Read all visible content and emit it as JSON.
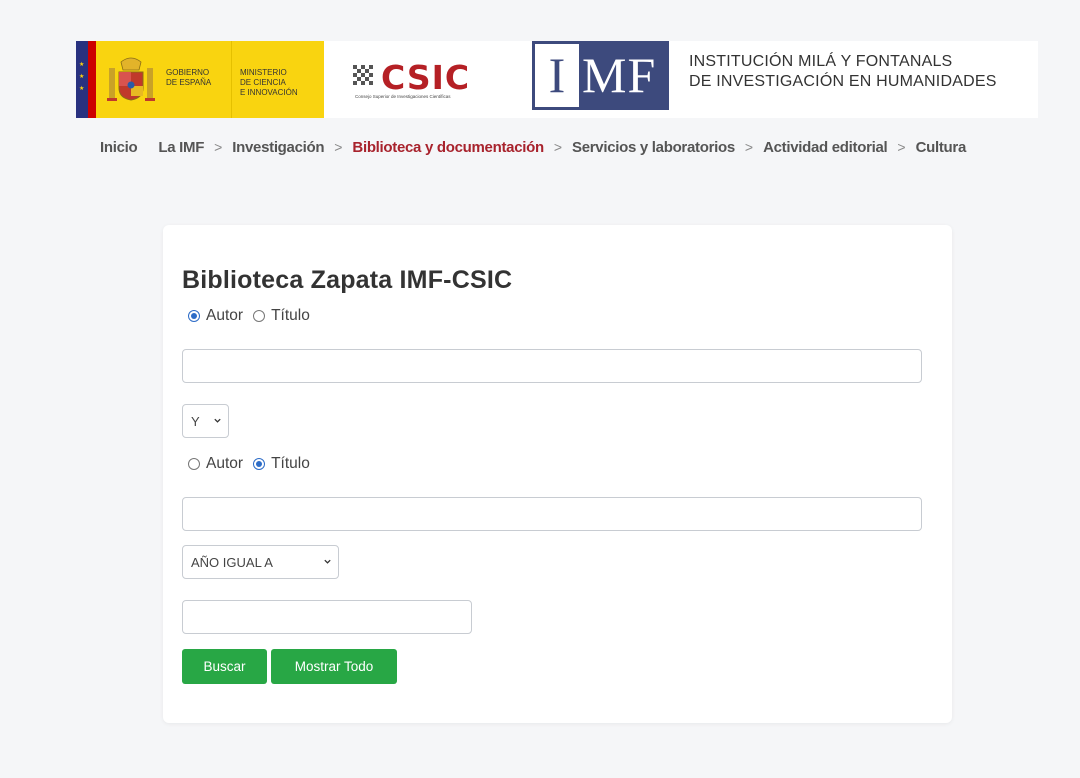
{
  "header": {
    "gov_line1": "Gobierno\nde España",
    "ministry": "Ministerio\nde Ciencia\ne Innovación",
    "csic_word": "CSIC",
    "csic_subtitle": "Consejo Superior de Investigaciones Científicas",
    "imf_letter_i": "I",
    "imf_letters_mf": "MF",
    "institution_line1": "INSTITUCIÓN MILÁ Y FONTANALS",
    "institution_line2": "DE INVESTIGACIÓN EN HUMANIDADES"
  },
  "nav": {
    "items": [
      {
        "label": "Inicio"
      },
      {
        "label": "La IMF"
      },
      {
        "label": "Investigación"
      },
      {
        "label": "Biblioteca y documentación",
        "active": true
      },
      {
        "label": "Servicios y laboratorios"
      },
      {
        "label": "Actividad editorial"
      },
      {
        "label": "Cultura"
      }
    ],
    "separator": ">"
  },
  "search": {
    "title": "Biblioteca Zapata IMF-CSIC",
    "row1": {
      "option_autor": "Autor",
      "option_titulo": "Título",
      "selected": "Autor"
    },
    "field1_value": "",
    "operator_select": "Y",
    "row2": {
      "option_autor": "Autor",
      "option_titulo": "Título",
      "selected": "Título"
    },
    "field2_value": "",
    "year_select": "AÑO IGUAL A",
    "year_value": "",
    "search_button": "Buscar",
    "show_all_button": "Mostrar Todo"
  },
  "colors": {
    "active_nav": "#a8232d",
    "button_green": "#28a745",
    "radio_blue": "#2d6cc7",
    "csic_red": "#b52025",
    "imf_blue": "#3d4a7d",
    "gov_yellow": "#f9d410"
  }
}
